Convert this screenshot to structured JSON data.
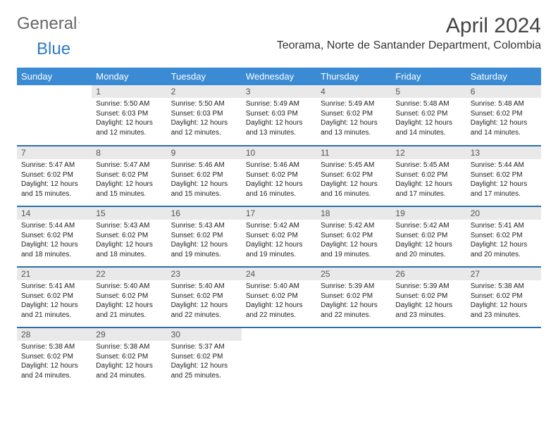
{
  "brand": {
    "part1": "General",
    "part2": "Blue"
  },
  "title": "April 2024",
  "location": "Teorama, Norte de Santander Department, Colombia",
  "weekdays": [
    "Sunday",
    "Monday",
    "Tuesday",
    "Wednesday",
    "Thursday",
    "Friday",
    "Saturday"
  ],
  "weeks": [
    [
      {
        "n": "",
        "sr": "",
        "ss": "",
        "dl": ""
      },
      {
        "n": "1",
        "sr": "5:50 AM",
        "ss": "6:03 PM",
        "dl": "12 hours and 12 minutes."
      },
      {
        "n": "2",
        "sr": "5:50 AM",
        "ss": "6:03 PM",
        "dl": "12 hours and 12 minutes."
      },
      {
        "n": "3",
        "sr": "5:49 AM",
        "ss": "6:03 PM",
        "dl": "12 hours and 13 minutes."
      },
      {
        "n": "4",
        "sr": "5:49 AM",
        "ss": "6:02 PM",
        "dl": "12 hours and 13 minutes."
      },
      {
        "n": "5",
        "sr": "5:48 AM",
        "ss": "6:02 PM",
        "dl": "12 hours and 14 minutes."
      },
      {
        "n": "6",
        "sr": "5:48 AM",
        "ss": "6:02 PM",
        "dl": "12 hours and 14 minutes."
      }
    ],
    [
      {
        "n": "7",
        "sr": "5:47 AM",
        "ss": "6:02 PM",
        "dl": "12 hours and 15 minutes."
      },
      {
        "n": "8",
        "sr": "5:47 AM",
        "ss": "6:02 PM",
        "dl": "12 hours and 15 minutes."
      },
      {
        "n": "9",
        "sr": "5:46 AM",
        "ss": "6:02 PM",
        "dl": "12 hours and 15 minutes."
      },
      {
        "n": "10",
        "sr": "5:46 AM",
        "ss": "6:02 PM",
        "dl": "12 hours and 16 minutes."
      },
      {
        "n": "11",
        "sr": "5:45 AM",
        "ss": "6:02 PM",
        "dl": "12 hours and 16 minutes."
      },
      {
        "n": "12",
        "sr": "5:45 AM",
        "ss": "6:02 PM",
        "dl": "12 hours and 17 minutes."
      },
      {
        "n": "13",
        "sr": "5:44 AM",
        "ss": "6:02 PM",
        "dl": "12 hours and 17 minutes."
      }
    ],
    [
      {
        "n": "14",
        "sr": "5:44 AM",
        "ss": "6:02 PM",
        "dl": "12 hours and 18 minutes."
      },
      {
        "n": "15",
        "sr": "5:43 AM",
        "ss": "6:02 PM",
        "dl": "12 hours and 18 minutes."
      },
      {
        "n": "16",
        "sr": "5:43 AM",
        "ss": "6:02 PM",
        "dl": "12 hours and 19 minutes."
      },
      {
        "n": "17",
        "sr": "5:42 AM",
        "ss": "6:02 PM",
        "dl": "12 hours and 19 minutes."
      },
      {
        "n": "18",
        "sr": "5:42 AM",
        "ss": "6:02 PM",
        "dl": "12 hours and 19 minutes."
      },
      {
        "n": "19",
        "sr": "5:42 AM",
        "ss": "6:02 PM",
        "dl": "12 hours and 20 minutes."
      },
      {
        "n": "20",
        "sr": "5:41 AM",
        "ss": "6:02 PM",
        "dl": "12 hours and 20 minutes."
      }
    ],
    [
      {
        "n": "21",
        "sr": "5:41 AM",
        "ss": "6:02 PM",
        "dl": "12 hours and 21 minutes."
      },
      {
        "n": "22",
        "sr": "5:40 AM",
        "ss": "6:02 PM",
        "dl": "12 hours and 21 minutes."
      },
      {
        "n": "23",
        "sr": "5:40 AM",
        "ss": "6:02 PM",
        "dl": "12 hours and 22 minutes."
      },
      {
        "n": "24",
        "sr": "5:40 AM",
        "ss": "6:02 PM",
        "dl": "12 hours and 22 minutes."
      },
      {
        "n": "25",
        "sr": "5:39 AM",
        "ss": "6:02 PM",
        "dl": "12 hours and 22 minutes."
      },
      {
        "n": "26",
        "sr": "5:39 AM",
        "ss": "6:02 PM",
        "dl": "12 hours and 23 minutes."
      },
      {
        "n": "27",
        "sr": "5:38 AM",
        "ss": "6:02 PM",
        "dl": "12 hours and 23 minutes."
      }
    ],
    [
      {
        "n": "28",
        "sr": "5:38 AM",
        "ss": "6:02 PM",
        "dl": "12 hours and 24 minutes."
      },
      {
        "n": "29",
        "sr": "5:38 AM",
        "ss": "6:02 PM",
        "dl": "12 hours and 24 minutes."
      },
      {
        "n": "30",
        "sr": "5:37 AM",
        "ss": "6:02 PM",
        "dl": "12 hours and 25 minutes."
      },
      {
        "n": "",
        "sr": "",
        "ss": "",
        "dl": ""
      },
      {
        "n": "",
        "sr": "",
        "ss": "",
        "dl": ""
      },
      {
        "n": "",
        "sr": "",
        "ss": "",
        "dl": ""
      },
      {
        "n": "",
        "sr": "",
        "ss": "",
        "dl": ""
      }
    ]
  ],
  "labels": {
    "sunrise": "Sunrise: ",
    "sunset": "Sunset: ",
    "daylight": "Daylight: "
  }
}
